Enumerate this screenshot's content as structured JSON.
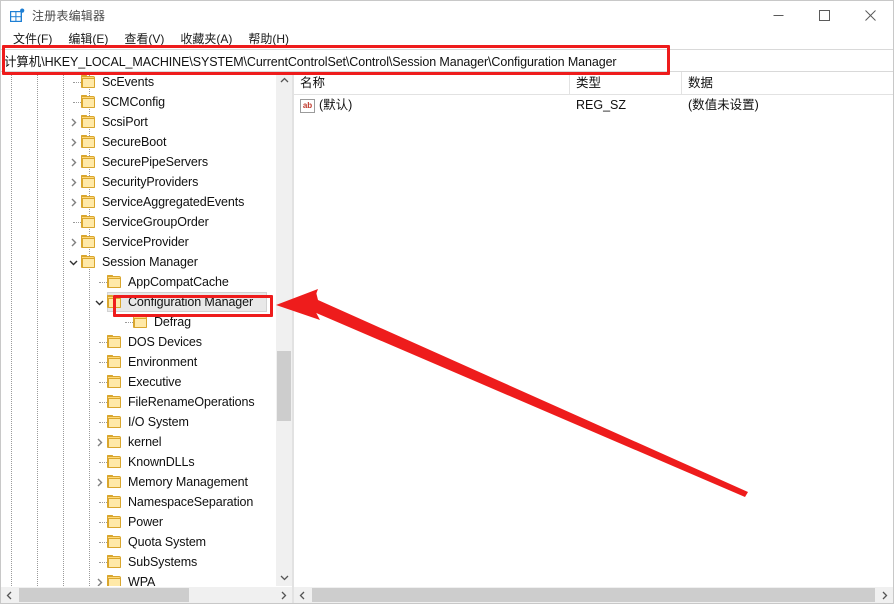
{
  "window": {
    "title": "注册表编辑器",
    "icon": "registry-editor-icon",
    "minimize_label": "—",
    "maximize_label": "□",
    "close_label": "✕"
  },
  "menubar": {
    "items": [
      {
        "label": "文件(F)",
        "name": "menu-file"
      },
      {
        "label": "编辑(E)",
        "name": "menu-edit"
      },
      {
        "label": "查看(V)",
        "name": "menu-view"
      },
      {
        "label": "收藏夹(A)",
        "name": "menu-favorites"
      },
      {
        "label": "帮助(H)",
        "name": "menu-help"
      }
    ]
  },
  "address": {
    "path": "计算机\\HKEY_LOCAL_MACHINE\\SYSTEM\\CurrentControlSet\\Control\\Session Manager\\Configuration Manager",
    "placeholder": ""
  },
  "tree": {
    "nodes": [
      {
        "label": "ScEvents",
        "depth": 4,
        "twisty": "none",
        "selected": false
      },
      {
        "label": "SCMConfig",
        "depth": 4,
        "twisty": "none",
        "selected": false
      },
      {
        "label": "ScsiPort",
        "depth": 4,
        "twisty": "collapsed",
        "selected": false
      },
      {
        "label": "SecureBoot",
        "depth": 4,
        "twisty": "collapsed",
        "selected": false
      },
      {
        "label": "SecurePipeServers",
        "depth": 4,
        "twisty": "collapsed",
        "selected": false
      },
      {
        "label": "SecurityProviders",
        "depth": 4,
        "twisty": "collapsed",
        "selected": false
      },
      {
        "label": "ServiceAggregatedEvents",
        "depth": 4,
        "twisty": "collapsed",
        "selected": false
      },
      {
        "label": "ServiceGroupOrder",
        "depth": 4,
        "twisty": "none",
        "selected": false
      },
      {
        "label": "ServiceProvider",
        "depth": 4,
        "twisty": "collapsed",
        "selected": false
      },
      {
        "label": "Session Manager",
        "depth": 4,
        "twisty": "expanded",
        "selected": false
      },
      {
        "label": "AppCompatCache",
        "depth": 5,
        "twisty": "none",
        "selected": false
      },
      {
        "label": "Configuration Manager",
        "depth": 5,
        "twisty": "expanded",
        "selected": true
      },
      {
        "label": "Defrag",
        "depth": 6,
        "twisty": "none",
        "selected": false
      },
      {
        "label": "DOS Devices",
        "depth": 5,
        "twisty": "none",
        "selected": false
      },
      {
        "label": "Environment",
        "depth": 5,
        "twisty": "none",
        "selected": false
      },
      {
        "label": "Executive",
        "depth": 5,
        "twisty": "none",
        "selected": false
      },
      {
        "label": "FileRenameOperations",
        "depth": 5,
        "twisty": "none",
        "selected": false
      },
      {
        "label": "I/O System",
        "depth": 5,
        "twisty": "none",
        "selected": false
      },
      {
        "label": "kernel",
        "depth": 5,
        "twisty": "collapsed",
        "selected": false
      },
      {
        "label": "KnownDLLs",
        "depth": 5,
        "twisty": "none",
        "selected": false
      },
      {
        "label": "Memory Management",
        "depth": 5,
        "twisty": "collapsed",
        "selected": false
      },
      {
        "label": "NamespaceSeparation",
        "depth": 5,
        "twisty": "none",
        "selected": false
      },
      {
        "label": "Power",
        "depth": 5,
        "twisty": "none",
        "selected": false
      },
      {
        "label": "Quota System",
        "depth": 5,
        "twisty": "none",
        "selected": false
      },
      {
        "label": "SubSystems",
        "depth": 5,
        "twisty": "none",
        "selected": false
      },
      {
        "label": "WPA",
        "depth": 5,
        "twisty": "collapsed",
        "selected": false
      }
    ]
  },
  "values": {
    "columns": [
      {
        "label": "名称",
        "name": "column-name"
      },
      {
        "label": "类型",
        "name": "column-type"
      },
      {
        "label": "数据",
        "name": "column-data"
      }
    ],
    "rows": [
      {
        "name": "(默认)",
        "type": "REG_SZ",
        "data": "(数值未设置)",
        "icon": "string-value-icon"
      }
    ]
  },
  "annotations": {
    "highlight_color": "#ee1c1c",
    "address_box": "highlight-address-bar",
    "key_box": "highlight-configuration-manager",
    "arrow": "pointer-arrow-to-configuration-manager"
  }
}
